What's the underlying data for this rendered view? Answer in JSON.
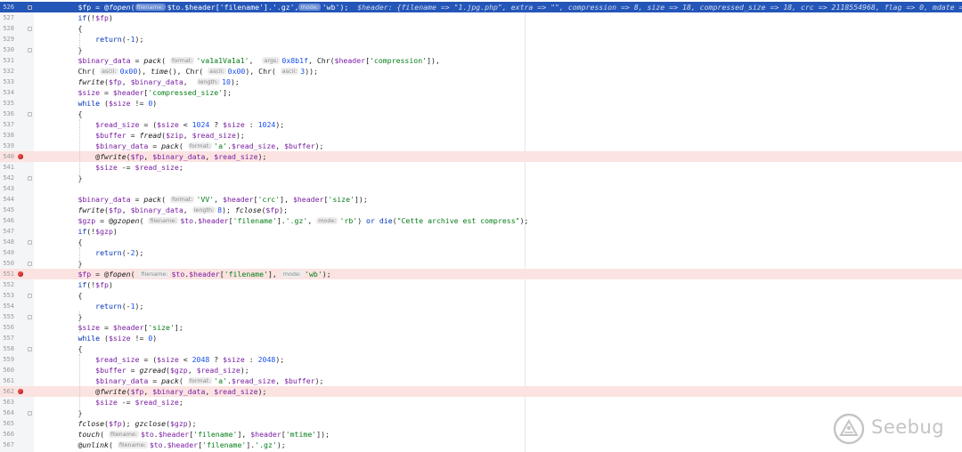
{
  "editor": {
    "lines": [
      {
        "n": "526",
        "current": true,
        "fold": true,
        "indent": 2,
        "html": "<span class=\"var\">$fp</span> = @<span class=\"fn\">fopen</span>(<span class=\"hint\">filename:</span>$to.$header[<span class=\"str\">'filename'</span>].<span class=\"str\">'.gz'</span>,<span class=\"hint\">mode:</span><span class=\"str\">'wb'</span>);  <span class=\"debug-val\">$header: {filename => \"1.jpg.php\", extra => \"\", compression => 8, size => 18, compressed_size => 18, crc => 2118554968, flag => 0, mdate => 21680</span>"
      },
      {
        "n": "527",
        "indent": 2,
        "html": "<span class=\"kw\">if</span>(!<span class=\"var\">$fp</span>)"
      },
      {
        "n": "528",
        "indent": 2,
        "fold": true,
        "html": "{"
      },
      {
        "n": "529",
        "indent": 3,
        "html": "<span class=\"kw\">return</span>(-<span class=\"num\">1</span>);"
      },
      {
        "n": "530",
        "indent": 2,
        "fold": true,
        "html": "}"
      },
      {
        "n": "531",
        "indent": 2,
        "html": "<span class=\"var\">$binary_data</span> = <span class=\"fn\">pack</span>( <span class=\"hint\">format:</span><span class=\"str\">'va1a1Va1a1'</span>,  <span class=\"hint\">args:</span><span class=\"num\">0x8b1f</span>, Chr(<span class=\"var\">$header</span>[<span class=\"str\">'compression'</span>]),"
      },
      {
        "n": "532",
        "indent": 2,
        "html": "Chr( <span class=\"hint\">ascii:</span><span class=\"num\">0x00</span>), <span class=\"fn\">time</span>(), Chr( <span class=\"hint\">ascii:</span><span class=\"num\">0x00</span>), Chr( <span class=\"hint\">ascii:</span><span class=\"num\">3</span>));"
      },
      {
        "n": "533",
        "indent": 2,
        "html": "<span class=\"fn\">fwrite</span>(<span class=\"var\">$fp</span>, <span class=\"var\">$binary_data</span>,  <span class=\"hint\">length:</span><span class=\"num\">10</span>);"
      },
      {
        "n": "534",
        "indent": 2,
        "html": "<span class=\"var\">$size</span> = <span class=\"var\">$header</span>[<span class=\"str\">'compressed_size'</span>];"
      },
      {
        "n": "535",
        "indent": 2,
        "html": "<span class=\"kw\">while</span> (<span class=\"var\">$size</span> != <span class=\"num\">0</span>)"
      },
      {
        "n": "536",
        "indent": 2,
        "fold": true,
        "html": "{"
      },
      {
        "n": "537",
        "indent": 3,
        "html": "<span class=\"var\">$read_size</span> = (<span class=\"var\">$size</span> &lt; <span class=\"num\">1024</span> ? <span class=\"var\">$size</span> : <span class=\"num\">1024</span>);"
      },
      {
        "n": "538",
        "indent": 3,
        "html": "<span class=\"var\">$buffer</span> = <span class=\"fn\">fread</span>(<span class=\"var\">$zip</span>, <span class=\"var\">$read_size</span>);"
      },
      {
        "n": "539",
        "indent": 3,
        "html": "<span class=\"var\">$binary_data</span> = <span class=\"fn\">pack</span>( <span class=\"hint\">format:</span><span class=\"str\">'a'</span>.<span class=\"var\">$read_size</span>, <span class=\"var\">$buffer</span>);"
      },
      {
        "n": "540",
        "indent": 3,
        "bp": true,
        "html": "@<span class=\"fn\">fwrite</span>(<span class=\"var\">$fp</span>, <span class=\"var\">$binary_data</span>, <span class=\"var\">$read_size</span>);"
      },
      {
        "n": "541",
        "indent": 3,
        "html": "<span class=\"var\">$size</span> -= <span class=\"var\">$read_size</span>;"
      },
      {
        "n": "542",
        "indent": 2,
        "fold": true,
        "html": "}"
      },
      {
        "n": "543",
        "indent": 2,
        "html": ""
      },
      {
        "n": "544",
        "indent": 2,
        "html": "<span class=\"var\">$binary_data</span> = <span class=\"fn\">pack</span>( <span class=\"hint\">format:</span><span class=\"str\">'VV'</span>, <span class=\"var\">$header</span>[<span class=\"str\">'crc'</span>], <span class=\"var\">$header</span>[<span class=\"str\">'size'</span>]);"
      },
      {
        "n": "545",
        "indent": 2,
        "html": "<span class=\"fn\">fwrite</span>(<span class=\"var\">$fp</span>, <span class=\"var\">$binary_data</span>, <span class=\"hint\">length:</span><span class=\"num\">8</span>); <span class=\"fn\">fclose</span>(<span class=\"var\">$fp</span>);"
      },
      {
        "n": "546",
        "indent": 2,
        "html": "<span class=\"var\">$gzp</span> = @<span class=\"fn\">gzopen</span>( <span class=\"hint\">filename:</span><span class=\"var\">$to</span>.<span class=\"var\">$header</span>[<span class=\"str\">'filename'</span>].<span class=\"str\">'.gz'</span>, <span class=\"hint\">mode:</span><span class=\"str\">'rb'</span>) <span class=\"kw\">or</span> <span class=\"kw\">die</span>(<span class=\"str\">\"Cette archive est compress\"</span>);"
      },
      {
        "n": "547",
        "indent": 2,
        "html": "<span class=\"kw\">if</span>(!<span class=\"var\">$gzp</span>)"
      },
      {
        "n": "548",
        "indent": 2,
        "fold": true,
        "html": "{"
      },
      {
        "n": "549",
        "indent": 3,
        "html": "<span class=\"kw\">return</span>(-<span class=\"num\">2</span>);"
      },
      {
        "n": "550",
        "indent": 2,
        "fold": true,
        "html": "}"
      },
      {
        "n": "551",
        "indent": 2,
        "bp": true,
        "html": "<span class=\"var\">$fp</span> = @<span class=\"fn\">fopen</span>( <span class=\"hint\">filename:</span><span class=\"var\">$to</span>.<span class=\"var\">$header</span>[<span class=\"str\">'filename'</span>], <span class=\"hint\">mode:</span><span class=\"str\">'wb'</span>);"
      },
      {
        "n": "552",
        "indent": 2,
        "html": "<span class=\"kw\">if</span>(!<span class=\"var\">$fp</span>)"
      },
      {
        "n": "553",
        "indent": 2,
        "fold": true,
        "html": "{"
      },
      {
        "n": "554",
        "indent": 3,
        "html": "<span class=\"kw\">return</span>(-<span class=\"num\">1</span>);"
      },
      {
        "n": "555",
        "indent": 2,
        "fold": true,
        "html": "}"
      },
      {
        "n": "556",
        "indent": 2,
        "html": "<span class=\"var\">$size</span> = <span class=\"var\">$header</span>[<span class=\"str\">'size'</span>];"
      },
      {
        "n": "557",
        "indent": 2,
        "html": "<span class=\"kw\">while</span> (<span class=\"var\">$size</span> != <span class=\"num\">0</span>)"
      },
      {
        "n": "558",
        "indent": 2,
        "fold": true,
        "html": "{"
      },
      {
        "n": "559",
        "indent": 3,
        "html": "<span class=\"var\">$read_size</span> = (<span class=\"var\">$size</span> &lt; <span class=\"num\">2048</span> ? <span class=\"var\">$size</span> : <span class=\"num\">2048</span>);"
      },
      {
        "n": "560",
        "indent": 3,
        "html": "<span class=\"var\">$buffer</span> = <span class=\"fn\">gzread</span>(<span class=\"var\">$gzp</span>, <span class=\"var\">$read_size</span>);"
      },
      {
        "n": "561",
        "indent": 3,
        "html": "<span class=\"var\">$binary_data</span> = <span class=\"fn\">pack</span>( <span class=\"hint\">format:</span><span class=\"str\">'a'</span>.<span class=\"var\">$read_size</span>, <span class=\"var\">$buffer</span>);"
      },
      {
        "n": "562",
        "indent": 3,
        "bp": true,
        "html": "@<span class=\"fn\">fwrite</span>(<span class=\"var\">$fp</span>, <span class=\"var\">$binary_data</span>, <span class=\"var\">$read_size</span>);"
      },
      {
        "n": "563",
        "indent": 3,
        "html": "<span class=\"var\">$size</span> -= <span class=\"var\">$read_size</span>;"
      },
      {
        "n": "564",
        "indent": 2,
        "fold": true,
        "html": "}"
      },
      {
        "n": "565",
        "indent": 2,
        "html": "<span class=\"fn\">fclose</span>(<span class=\"var\">$fp</span>); <span class=\"fn\">gzclose</span>(<span class=\"var\">$gzp</span>);"
      },
      {
        "n": "566",
        "indent": 2,
        "html": "<span class=\"fn\">touch</span>( <span class=\"hint\">filename:</span><span class=\"var\">$to</span>.<span class=\"var\">$header</span>[<span class=\"str\">'filename'</span>], <span class=\"var\">$header</span>[<span class=\"str\">'mtime'</span>]);"
      },
      {
        "n": "567",
        "indent": 2,
        "html": "@<span class=\"fn\">unlink</span>( <span class=\"hint\">filename:</span><span class=\"var\">$to</span>.<span class=\"var\">$header</span>[<span class=\"str\">'filename'</span>].<span class=\"str\">'.gz'</span>);"
      }
    ]
  },
  "watermark": {
    "text": "Seebug"
  },
  "colors": {
    "current_line": "#2456b8",
    "breakpoint_line": "#fbe3e1",
    "breakpoint_dot": "#e14242",
    "keyword": "#0033b3",
    "variable": "#7a1fa3",
    "string": "#067d17",
    "number": "#1750eb"
  }
}
